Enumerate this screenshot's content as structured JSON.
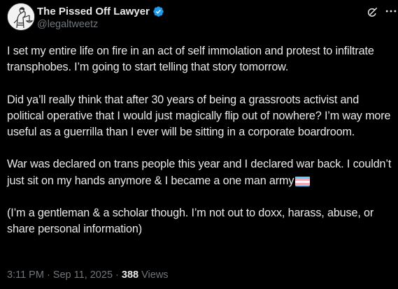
{
  "post": {
    "author": {
      "display_name": "The Pissed Off Lawyer",
      "handle": "@legaltweetz",
      "verified": true,
      "avatar_icon": "justice-statue-avatar"
    },
    "actions": {
      "grok_icon": "grok-icon",
      "more_icon": "more-options-icon"
    },
    "paragraphs": [
      "I set my entire life on fire in an act of self immolation and protest to infiltrate transphobes. I’m going to start telling that story tomorrow.",
      "Did ya’ll really think that after 30 years of being a grassroots activist and political operative that I would just magically flip out of nowhere? I’m way more useful as a guerrilla than I ever will be sitting in a corporate boardroom.",
      "War was declared on trans people this year and I declared war back. I couldn’t just sit on my hands anymore & I became a one man army",
      "(I’m a gentleman & a scholar though. I’m not out to doxx, harass, abuse, or share personal information)"
    ],
    "emoji": "transgender-flag",
    "timestamp": "3:11 PM · Sep 11, 2025",
    "separator": " · ",
    "views_count": "388",
    "views_label": " Views"
  },
  "colors": {
    "background": "#000000",
    "text": "#e7e9ea",
    "secondary": "#71767b",
    "verified": "#1d9bf0",
    "flag_blue": "#5bcefa",
    "flag_pink": "#f5a9b8",
    "flag_white": "#ffffff"
  }
}
